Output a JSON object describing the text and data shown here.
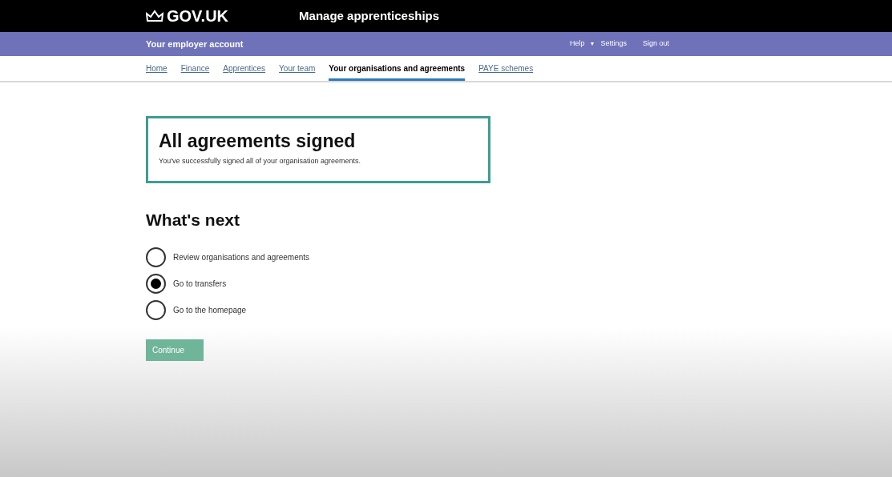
{
  "header": {
    "logo": "GOV.UK",
    "service": "Manage apprenticeships"
  },
  "account_bar": {
    "title": "Your employer account",
    "links": [
      {
        "label": "Help",
        "kind": "link"
      },
      {
        "label": "▾",
        "kind": "caret"
      },
      {
        "label": "Settings",
        "kind": "link"
      },
      {
        "label": "Sign out",
        "kind": "link"
      }
    ]
  },
  "nav": [
    {
      "label": "Home",
      "selected": false
    },
    {
      "label": "Finance",
      "selected": false
    },
    {
      "label": "Apprentices",
      "selected": false
    },
    {
      "label": "Your team",
      "selected": false
    },
    {
      "label": "Your organisations and agreements",
      "selected": true
    },
    {
      "label": "PAYE schemes",
      "selected": false
    }
  ],
  "panel": {
    "title": "All agreements signed",
    "body": "You've successfully signed all of your organisation agreements."
  },
  "heading": "What's next",
  "options": [
    {
      "label": "Review organisations and agreements",
      "selected": false
    },
    {
      "label": "Go to transfers",
      "selected": true
    },
    {
      "label": "Go to the homepage",
      "selected": false
    }
  ],
  "button": "Continue"
}
